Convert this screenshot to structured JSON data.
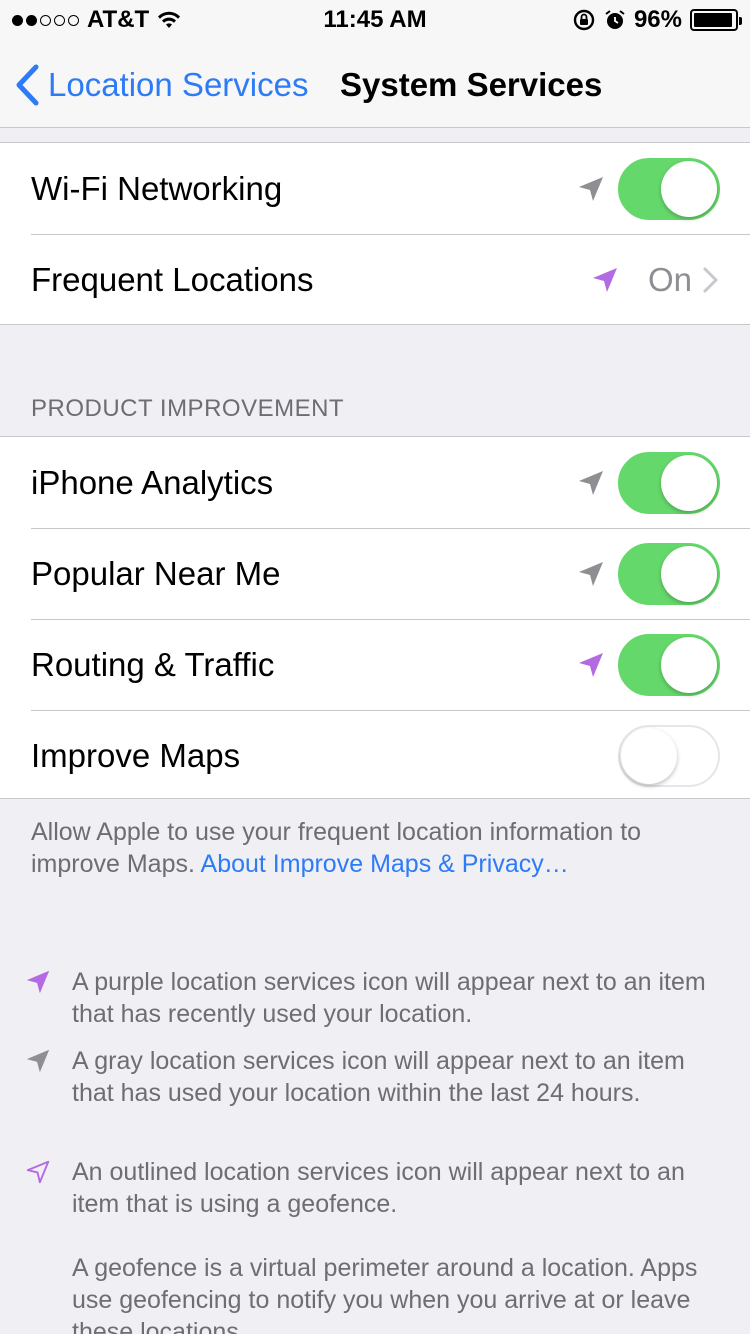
{
  "status_bar": {
    "carrier": "AT&T",
    "time": "11:45 AM",
    "battery": "96%",
    "battery_level": 0.96
  },
  "nav": {
    "back_label": "Location Services",
    "title": "System Services"
  },
  "top_group": [
    {
      "label": "Wi-Fi Networking",
      "arrow": "gray",
      "toggle": true
    },
    {
      "label": "Frequent Locations",
      "arrow": "purple",
      "value": "On"
    }
  ],
  "section": {
    "header": "PRODUCT IMPROVEMENT",
    "rows": [
      {
        "label": "iPhone Analytics",
        "arrow": "gray",
        "toggle": true
      },
      {
        "label": "Popular Near Me",
        "arrow": "gray",
        "toggle": true
      },
      {
        "label": "Routing & Traffic",
        "arrow": "purple",
        "toggle": true
      },
      {
        "label": "Improve Maps",
        "arrow": "none",
        "toggle": false
      }
    ]
  },
  "footer": {
    "text": "Allow Apple to use your frequent location information to improve Maps.",
    "link": "About Improve Maps & Privacy…"
  },
  "legend": [
    {
      "icon": "purple-arrow",
      "text": "A purple location services icon will appear next to an item that has recently used your location."
    },
    {
      "icon": "gray-arrow",
      "text": "A gray location services icon will appear next to an item that has used your location within the last 24 hours."
    },
    {
      "icon": "outlined-arrow",
      "text": "An outlined location services icon will appear next to an item that is using a geofence."
    }
  ],
  "geofence_note": "A geofence is a virtual perimeter around a location. Apps use geofencing to notify you when you arrive at or leave these locations.",
  "colors": {
    "accent": "#2e7bf6",
    "switch_on": "#65d86b",
    "arrow_gray": "#8e8e93",
    "arrow_purple": "#b36ae2"
  }
}
